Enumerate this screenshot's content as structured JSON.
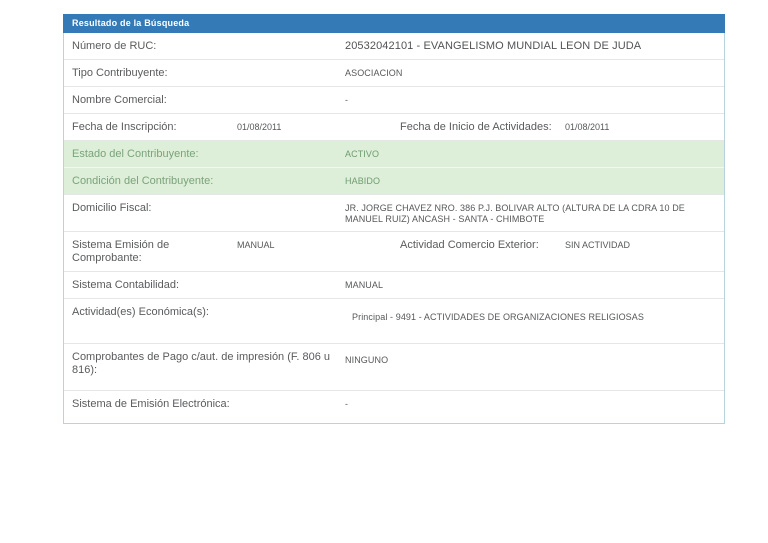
{
  "panel": {
    "title": "Resultado de la Búsqueda",
    "colors": {
      "header_bg": "#337ab7",
      "header_text": "#ffffff",
      "green_row_bg": "#ddefd8",
      "green_row_text": "#6f9c6f",
      "border": "#b9d3de"
    }
  },
  "rows": [
    {
      "label": "Número de RUC:",
      "value": "20532042101 - EVANGELISMO MUNDIAL LEON DE JUDA"
    },
    {
      "label": "Tipo Contribuyente:",
      "value": "ASOCIACION"
    },
    {
      "label": "Nombre Comercial:",
      "value": "-"
    },
    {
      "label": "Fecha de Inscripción:",
      "value": "01/08/2011",
      "label2": "Fecha de Inicio de Actividades:",
      "value2": "01/08/2011"
    },
    {
      "label": "Estado del Contribuyente:",
      "value": "ACTIVO",
      "status": "green"
    },
    {
      "label": "Condición del Contribuyente:",
      "value": "HABIDO",
      "status": "green"
    },
    {
      "label": "Domicilio Fiscal:",
      "value": "JR. JORGE CHAVEZ NRO. 386 P.J. BOLIVAR ALTO (ALTURA DE LA CDRA 10 DE MANUEL RUIZ) ANCASH - SANTA - CHIMBOTE"
    },
    {
      "label": "Sistema Emisión de Comprobante:",
      "value": "MANUAL",
      "label2": "Actividad Comercio Exterior:",
      "value2": "SIN ACTIVIDAD"
    },
    {
      "label": "Sistema Contabilidad:",
      "value": "MANUAL"
    },
    {
      "label": "Actividad(es) Económica(s):",
      "value": "Principal - 9491 - ACTIVIDADES DE ORGANIZACIONES RELIGIOSAS"
    },
    {
      "label": "Comprobantes de Pago c/aut. de impresión (F. 806 u 816):",
      "value": "NINGUNO"
    },
    {
      "label": "Sistema de Emisión Electrónica:",
      "value": "-"
    }
  ]
}
